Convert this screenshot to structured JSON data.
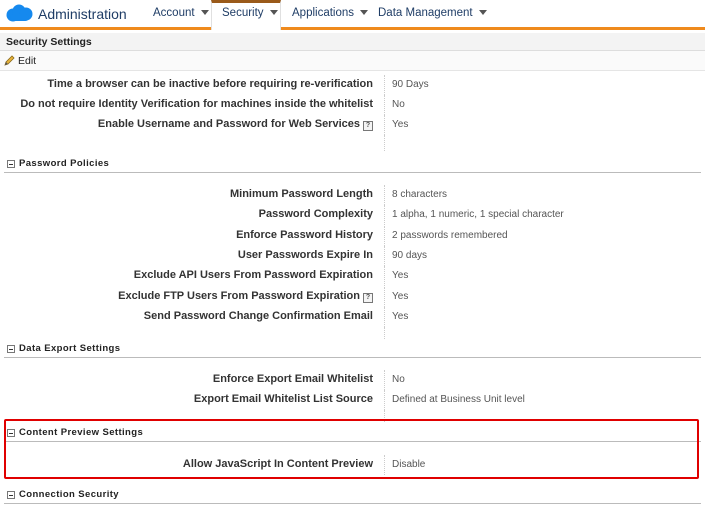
{
  "app": {
    "title": "Administration",
    "logo": "cloud-logo",
    "brand_color": "#1589ee",
    "accent": "#ef8a1d"
  },
  "nav": {
    "items": [
      {
        "label": "Account"
      },
      {
        "label": "Security"
      },
      {
        "label": "Applications"
      },
      {
        "label": "Data Management"
      }
    ],
    "active": "Security"
  },
  "page": {
    "title": "Security Settings",
    "edit_label": "Edit"
  },
  "general": [
    {
      "label": "Time a browser can be inactive before requiring re-verification",
      "value": "90 Days"
    },
    {
      "label": "Do not require Identity Verification for machines inside the whitelist",
      "value": "No"
    },
    {
      "label": "Enable Username and Password for Web Services",
      "value": "Yes",
      "help": "?"
    }
  ],
  "password_policies": {
    "title": "Password Policies",
    "rows": [
      {
        "label": "Minimum Password Length",
        "value": "8 characters"
      },
      {
        "label": "Password Complexity",
        "value": "1 alpha, 1 numeric, 1 special character"
      },
      {
        "label": "Enforce Password History",
        "value": "2 passwords remembered"
      },
      {
        "label": "User Passwords Expire In",
        "value": "90 days"
      },
      {
        "label": "Exclude API Users From Password Expiration",
        "value": "Yes"
      },
      {
        "label": "Exclude FTP Users From Password Expiration",
        "value": "Yes",
        "help": "?"
      },
      {
        "label": "Send Password Change Confirmation Email",
        "value": "Yes"
      }
    ]
  },
  "data_export": {
    "title": "Data Export Settings",
    "rows": [
      {
        "label": "Enforce Export Email Whitelist",
        "value": "No"
      },
      {
        "label": "Export Email Whitelist List Source",
        "value": "Defined at Business Unit level"
      }
    ]
  },
  "content_preview": {
    "title": "Content Preview Settings",
    "rows": [
      {
        "label": "Allow JavaScript In Content Preview",
        "value": "Disable"
      }
    ],
    "highlight_color": "#e00000"
  },
  "connection_security": {
    "title": "Connection Security"
  }
}
